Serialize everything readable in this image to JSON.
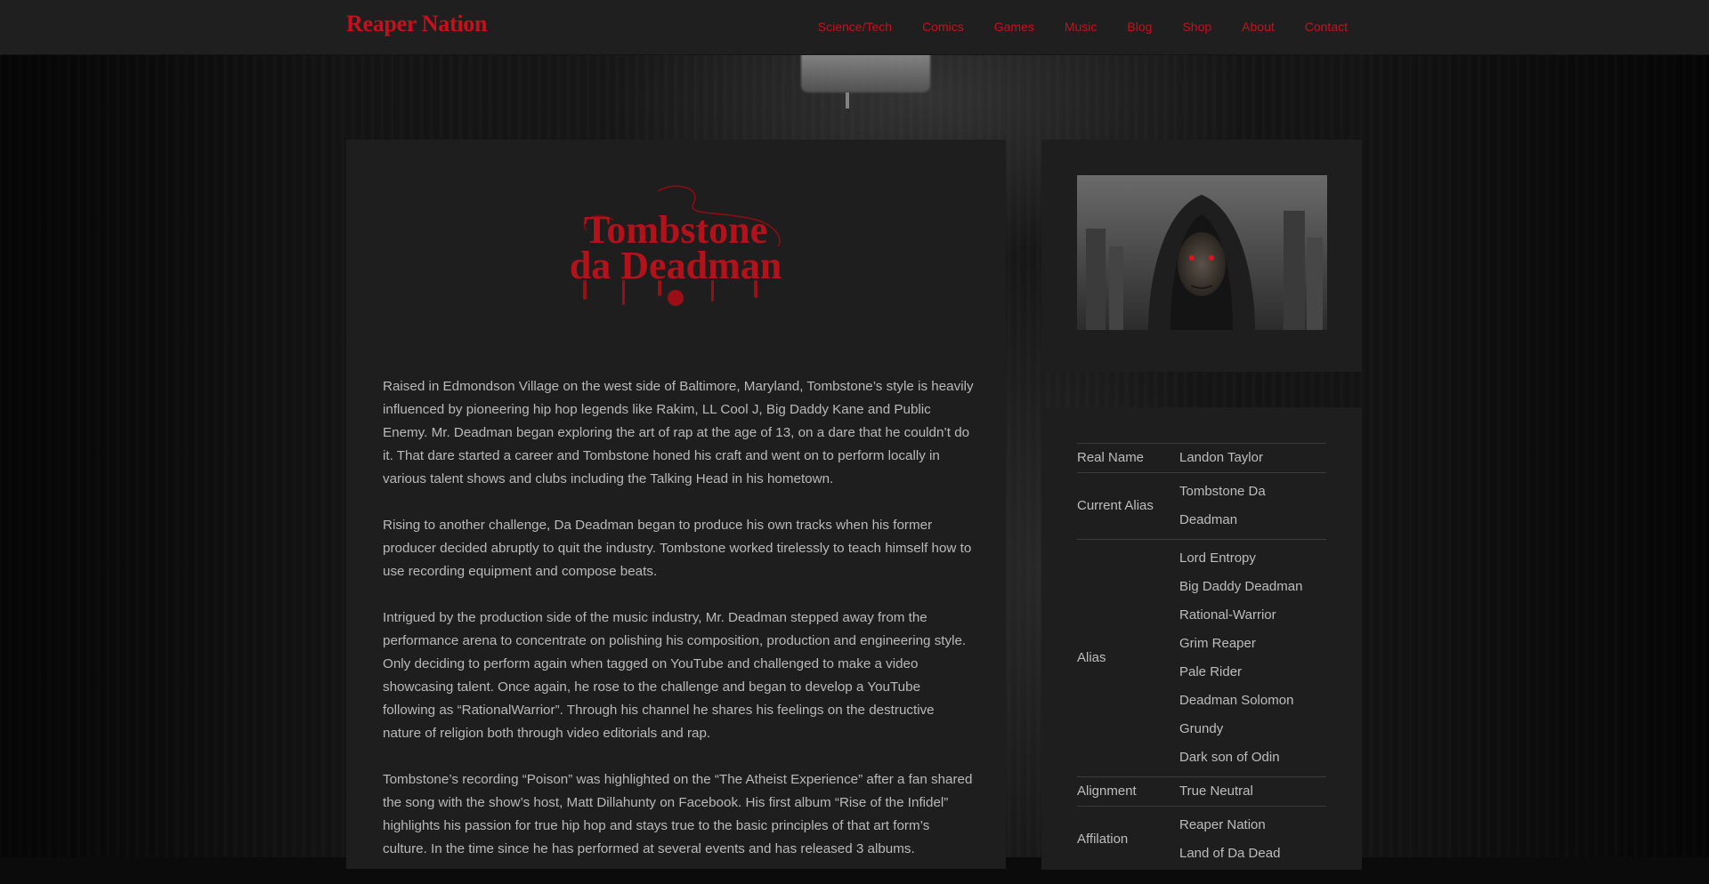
{
  "site": {
    "brand": "Reaper Nation",
    "nav": [
      "Science/Tech",
      "Comics",
      "Games",
      "Music",
      "Blog",
      "Shop",
      "About",
      "Contact"
    ]
  },
  "hero": {
    "logo_line1": "Tombstone",
    "logo_line2": "da Deadman"
  },
  "story": [
    "Raised in Edmondson Village on the west side of Baltimore, Maryland, Tombstone’s style is heavily influenced by pioneering hip hop legends like Rakim, LL Cool J, Big Daddy Kane and Public Enemy. Mr. Deadman began exploring the art of rap at the age of 13, on a dare that he couldn’t do it. That dare started a career and Tombstone honed his craft and went on to perform locally in various talent shows and clubs including the Talking Head in his hometown.",
    "Rising to another challenge, Da Deadman began to produce his own tracks when his former producer decided abruptly to quit the industry. Tombstone worked tirelessly to teach himself how to use recording equipment and compose beats.",
    "Intrigued by the production side of the music industry, Mr. Deadman stepped away from the performance arena to concentrate on polishing his composition, production and engineering style. Only deciding to perform again when tagged on YouTube and challenged to make a video showcasing talent. Once again, he rose to the challenge and began to develop a YouTube following as “RationalWarrior”. Through his channel he shares his feelings on the destructive nature of religion both through video editorials and rap.",
    "Tombstone’s  recording “Poison” was highlighted on the “The Atheist Experience” after a fan shared the song with the show’s host, Matt Dillahunty on Facebook. His first album “Rise of the Infidel” highlights his passion for true hip hop and stays true to the basic principles of that art form’s culture. In the time since he has performed at several events and has released 3 albums."
  ],
  "profile": {
    "real_name_label": "Real Name",
    "real_name": "Landon Taylor",
    "current_alias_label": "Current Alias",
    "current_alias_1": "Tombstone Da",
    "current_alias_2": "Deadman",
    "alias_label": "Alias",
    "aliases": [
      "Lord Entropy",
      "Big Daddy Deadman",
      "Rational-Warrior",
      "Grim Reaper",
      "Pale Rider",
      "Deadman Solomon",
      "Grundy",
      "Dark son of Odin"
    ],
    "alignment_label": "Alignment",
    "alignment": "True Neutral",
    "affiliation_label": "Affilation",
    "affiliations": [
      "Reaper Nation",
      "Land of Da Dead"
    ]
  },
  "colors": {
    "accent": "#c8101a",
    "panel": "#1e1e1e",
    "topbar": "#1f1f1f"
  }
}
